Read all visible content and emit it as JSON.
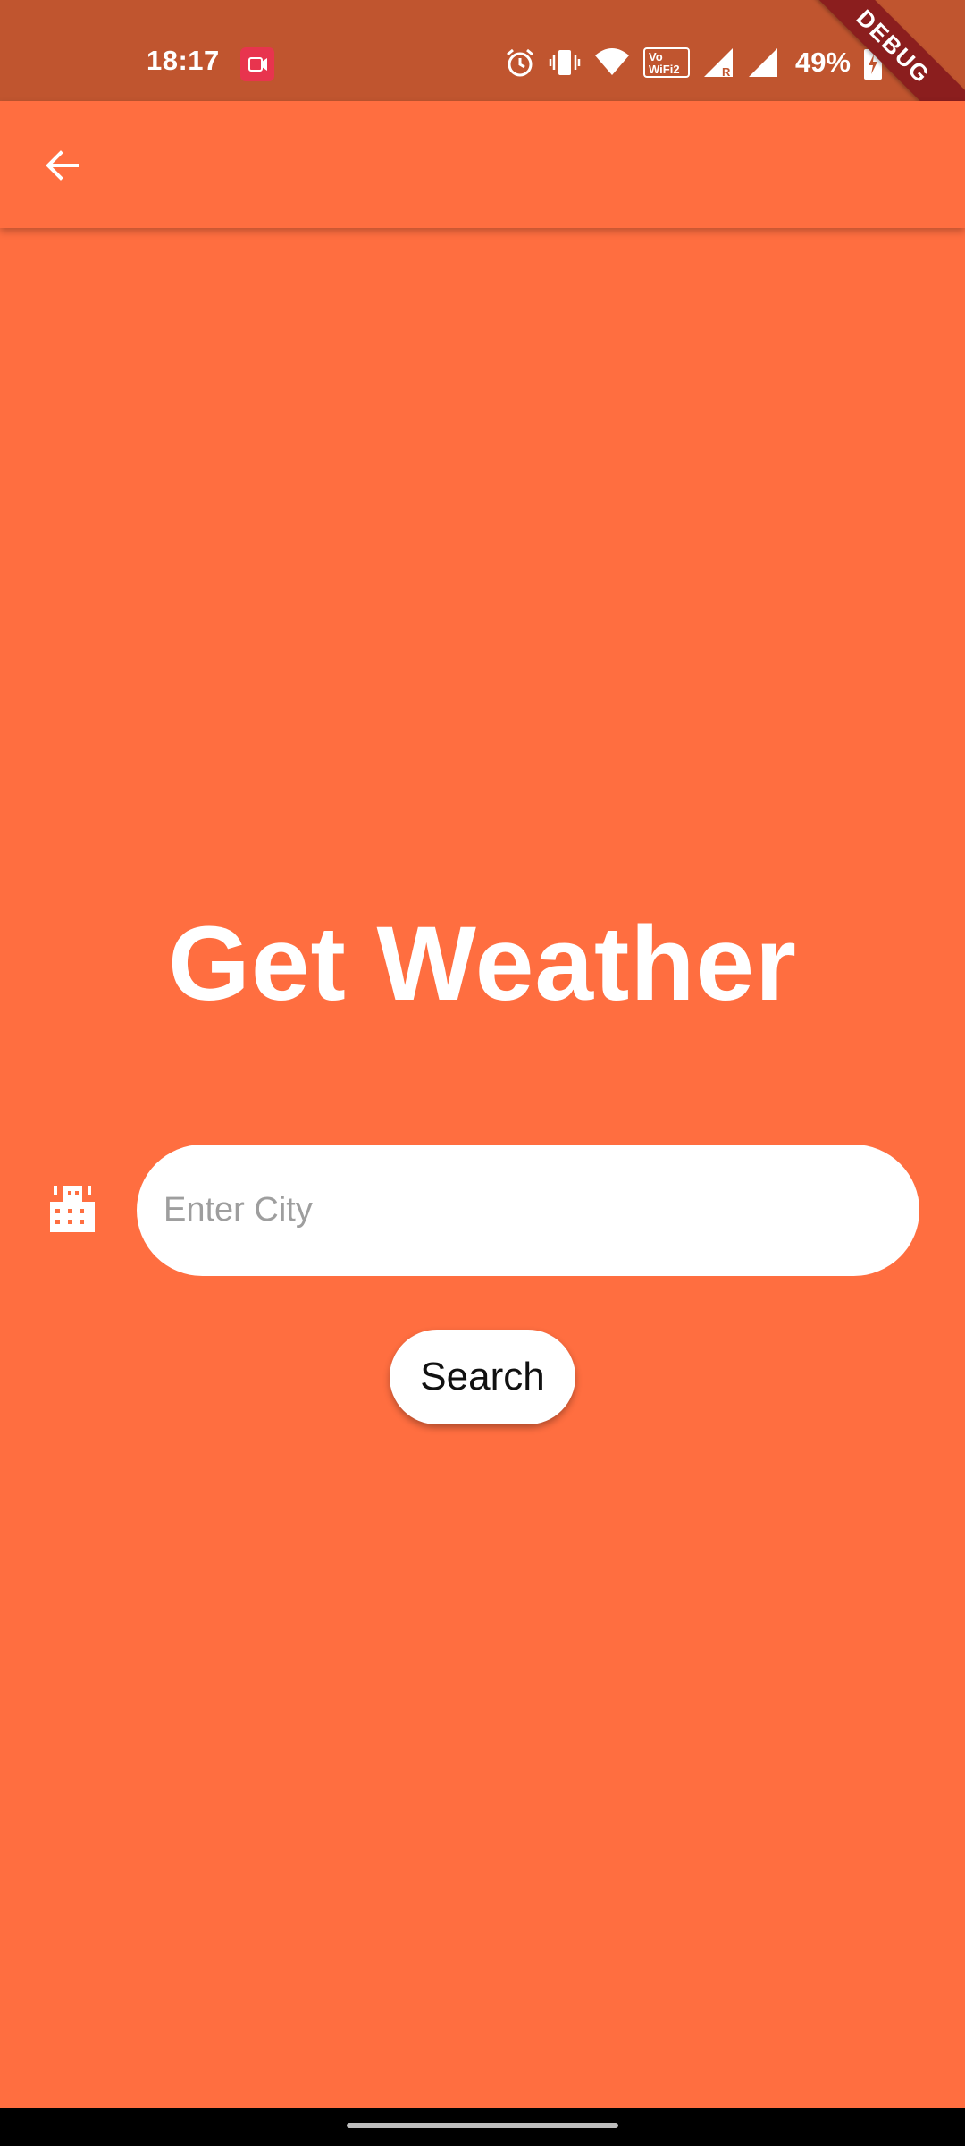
{
  "status_bar": {
    "time": "18:17",
    "battery_percent": "49%",
    "icons": [
      "screen-record-icon",
      "alarm-icon",
      "vibrate-icon",
      "wifi-icon",
      "vowifi-icon",
      "signal-roaming-icon",
      "signal-icon",
      "battery-charging-icon"
    ]
  },
  "debug_banner": {
    "label": "DEBUG"
  },
  "app_bar": {
    "back_icon": "arrow-back-icon"
  },
  "main": {
    "title": "Get Weather",
    "city_input": {
      "placeholder": "Enter City",
      "value": ""
    },
    "city_icon": "location-city-icon",
    "search_button": {
      "label": "Search"
    }
  },
  "colors": {
    "background": "#FF6E40",
    "status_bar": "#C0552F",
    "debug_ribbon": "#8B1E1E",
    "input_bg": "#FFFFFF"
  }
}
